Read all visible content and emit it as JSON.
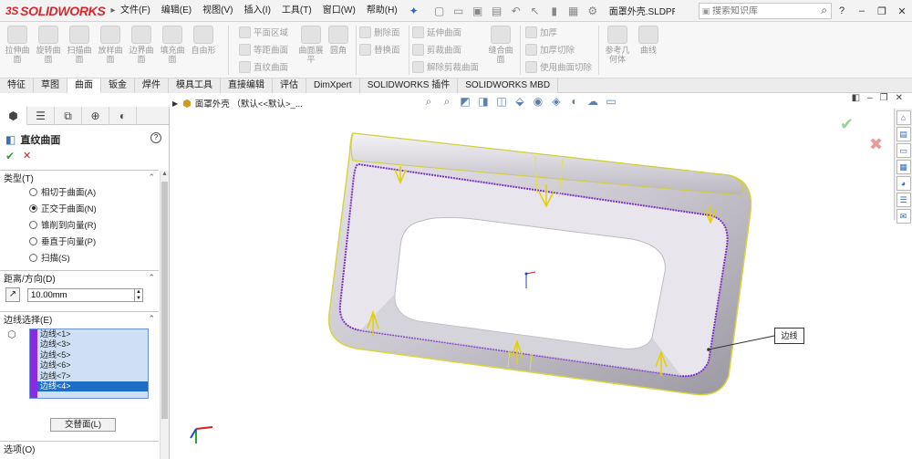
{
  "app": {
    "logo_ds": "3S",
    "logo_name": "SOLIDWORKS",
    "doc_title": "面罩外壳.SLDPR..."
  },
  "menu": [
    "文件(F)",
    "编辑(E)",
    "视图(V)",
    "插入(I)",
    "工具(T)",
    "窗口(W)",
    "帮助(H)"
  ],
  "search": {
    "placeholder": "搜索知识库"
  },
  "ribbon": {
    "big": [
      "拉伸曲面",
      "旋转曲面",
      "扫描曲面",
      "放样曲面",
      "边界曲面",
      "填充曲面",
      "自由形"
    ],
    "col1": [
      "平面区域",
      "等距曲面",
      "直纹曲面"
    ],
    "big2": [
      "曲面展平",
      "圆角"
    ],
    "col2": [
      "删除面",
      "替换面"
    ],
    "col3": [
      "延伸曲面",
      "剪裁曲面",
      "解除剪裁曲面"
    ],
    "big3": "缝合曲面",
    "col4": [
      "加厚",
      "加厚切除",
      "使用曲面切除"
    ],
    "big4": [
      "参考几何体",
      "曲线"
    ]
  },
  "tabs": [
    "特征",
    "草图",
    "曲面",
    "钣金",
    "焊件",
    "模具工具",
    "直接编辑",
    "评估",
    "DimXpert",
    "SOLIDWORKS 插件",
    "SOLIDWORKS MBD"
  ],
  "active_tab": "曲面",
  "panel": {
    "title": "直纹曲面",
    "type_section": "类型(T)",
    "type_options": [
      "相切于曲面(A)",
      "正交于曲面(N)",
      "锥削到向量(R)",
      "垂直于向量(P)",
      "扫描(S)"
    ],
    "selected_type": "正交于曲面(N)",
    "distance_section": "距离/方向(D)",
    "distance_value": "10.00mm",
    "edge_section": "边线选择(E)",
    "edges": [
      "边线<1>",
      "边线<3>",
      "边线<5>",
      "边线<6>",
      "边线<7>",
      "边线<4>"
    ],
    "selected_edge": "边线<4>",
    "swap_button": "交替面(L)",
    "options_section": "选项(O)"
  },
  "viewport": {
    "breadcrumb": "面罩外壳 （默认<<默认>_...",
    "callout": "边线"
  }
}
